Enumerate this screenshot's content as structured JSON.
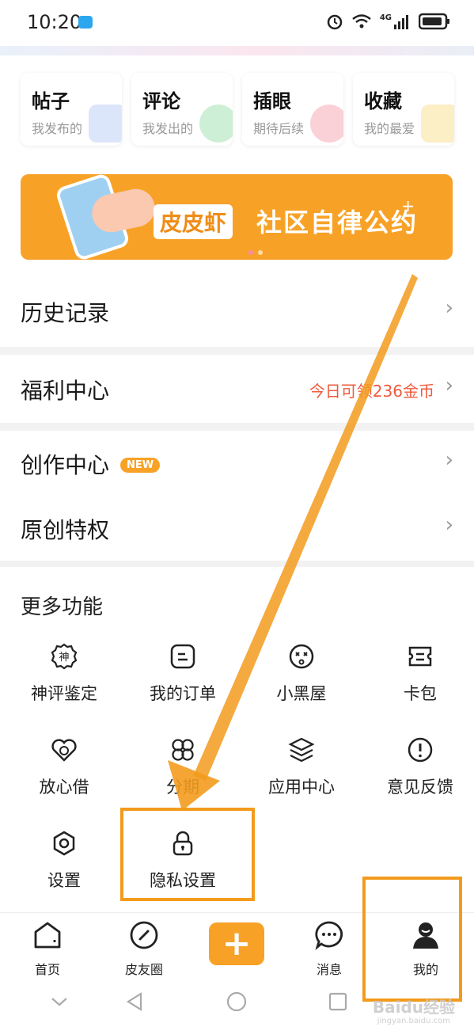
{
  "status_bar": {
    "time": "10:20",
    "network": "4G"
  },
  "quick_cards": [
    {
      "title": "帖子",
      "subtitle": "我发布的",
      "color": "#9bb8f0"
    },
    {
      "title": "评论",
      "subtitle": "我发出的",
      "color": "#6fd18a"
    },
    {
      "title": "插眼",
      "subtitle": "期待后续",
      "color": "#f07a8a"
    },
    {
      "title": "收藏",
      "subtitle": "我的最爱",
      "color": "#f6cf5a"
    }
  ],
  "promo": {
    "logo_text": "皮皮虾",
    "text": "社区自律公约",
    "plus": "+"
  },
  "rows": {
    "history": {
      "label": "历史记录",
      "chevron": "›"
    },
    "welfare": {
      "label": "福利中心",
      "extra": "今日可领236金币",
      "chevron": "›"
    },
    "creation": {
      "label": "创作中心",
      "badge": "NEW",
      "chevron": "›"
    },
    "original": {
      "label": "原创特权",
      "chevron": "›"
    }
  },
  "more": {
    "title": "更多功能",
    "items": [
      {
        "label": "神评鉴定",
        "icon": "shen-badge-icon"
      },
      {
        "label": "我的订单",
        "icon": "order-icon"
      },
      {
        "label": "小黑屋",
        "icon": "dizzy-face-icon"
      },
      {
        "label": "卡包",
        "icon": "card-icon"
      },
      {
        "label": "放心借",
        "icon": "heart-shield-icon"
      },
      {
        "label": "分期",
        "icon": "clover-icon"
      },
      {
        "label": "应用中心",
        "icon": "layers-icon"
      },
      {
        "label": "意见反馈",
        "icon": "alert-icon"
      },
      {
        "label": "设置",
        "icon": "gear-icon"
      },
      {
        "label": "隐私设置",
        "icon": "lock-icon"
      }
    ]
  },
  "tabbar": {
    "home": "首页",
    "circle": "皮友圈",
    "plus": "+",
    "messages": "消息",
    "mine": "我的"
  },
  "watermark": {
    "text": "Baidu经验",
    "sub": "jingyan.baidu.com"
  },
  "accent_color": "#f7a227",
  "annotation_color": "#f39b1d"
}
